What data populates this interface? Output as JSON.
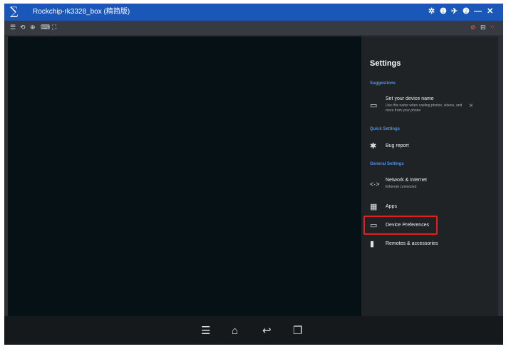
{
  "window": {
    "logo_glyph": "∑",
    "small_label": "",
    "title": "Rockchip-rk3328_box (精简版)",
    "controls": [
      "✲",
      "❶",
      "✈",
      "❷",
      "—",
      "✕"
    ]
  },
  "toolbar": {
    "left_icons": [
      "☰",
      "⟲",
      "⊕",
      "⌨",
      "⛶"
    ],
    "right_icons": [
      "⊘",
      "⊟",
      "⁘"
    ]
  },
  "settings": {
    "title": "Settings",
    "suggestions_header": "Suggestions",
    "device_name": {
      "label": "Set your device name",
      "sub": "Use this name when casting photos, videos, and more from your phone",
      "dismiss": "×"
    },
    "quick_header": "Quick Settings",
    "bug_report": "Bug report",
    "general_header": "General Settings",
    "network": {
      "label": "Network & Internet",
      "sub": "Ethernet connected"
    },
    "apps": "Apps",
    "device_prefs": "Device Preferences",
    "remotes": "Remotes & accessories"
  },
  "navbar": {
    "menu": "☰",
    "home": "⌂",
    "back": "↩",
    "recents": "❐"
  }
}
